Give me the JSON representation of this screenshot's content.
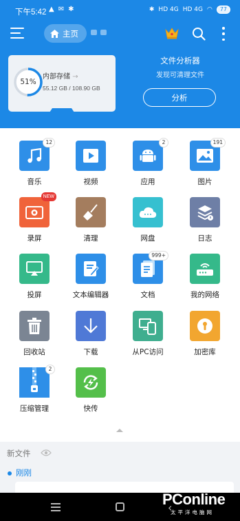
{
  "status_bar": {
    "time": "下午5:42",
    "battery": "77",
    "signal1": "HD 4G",
    "signal2": "HD 4G"
  },
  "toolbar": {
    "home_label": "主页"
  },
  "storage": {
    "percent": "51%",
    "percent_value": 51,
    "label": "内部存储",
    "size": "55.12 GB / 108.90 GB"
  },
  "analyzer": {
    "title": "文件分析器",
    "subtitle": "发现可清理文件",
    "button": "分析"
  },
  "grid": {
    "items": [
      {
        "label": "音乐",
        "badge": "12",
        "icon": "music-icon",
        "color": "#2e8fe8"
      },
      {
        "label": "视频",
        "badge": "",
        "icon": "video-icon",
        "color": "#2e8fe8"
      },
      {
        "label": "应用",
        "badge": "2",
        "icon": "android-icon",
        "color": "#2e8fe8"
      },
      {
        "label": "图片",
        "badge": "191",
        "icon": "image-icon",
        "color": "#2e8fe8"
      },
      {
        "label": "录屏",
        "badge": "NEW",
        "icon": "record-icon",
        "color": "#f0633a"
      },
      {
        "label": "清理",
        "badge": "",
        "icon": "broom-icon",
        "color": "#a47d5e"
      },
      {
        "label": "网盘",
        "badge": "",
        "icon": "cloud-drive-icon",
        "color": "#36c0d0"
      },
      {
        "label": "日志",
        "badge": "",
        "icon": "log-icon",
        "color": "#6e7fa6"
      },
      {
        "label": "投屏",
        "badge": "",
        "icon": "cast-icon",
        "color": "#35b98a"
      },
      {
        "label": "文本编辑器",
        "badge": "",
        "icon": "text-editor-icon",
        "color": "#2e8fe8"
      },
      {
        "label": "文档",
        "badge": "999+",
        "icon": "document-icon",
        "color": "#2e8fe8"
      },
      {
        "label": "我的网络",
        "badge": "",
        "icon": "router-icon",
        "color": "#35b98a"
      },
      {
        "label": "回收站",
        "badge": "",
        "icon": "trash-icon",
        "color": "#7b8593"
      },
      {
        "label": "下载",
        "badge": "",
        "icon": "download-icon",
        "color": "#4f79d6"
      },
      {
        "label": "从PC访问",
        "badge": "",
        "icon": "pc-access-icon",
        "color": "#3fae8f"
      },
      {
        "label": "加密库",
        "badge": "",
        "icon": "vault-icon",
        "color": "#f2a630"
      },
      {
        "label": "压缩管理",
        "badge": "2",
        "icon": "zip-icon",
        "color": "#2e8fe8"
      },
      {
        "label": "快传",
        "badge": "",
        "icon": "quick-transfer-icon",
        "color": "#54bf4a"
      }
    ]
  },
  "recent": {
    "title": "新文件",
    "group": "刚刚"
  },
  "watermark": {
    "brand": "PConline",
    "sub": "太平洋电脑网"
  }
}
